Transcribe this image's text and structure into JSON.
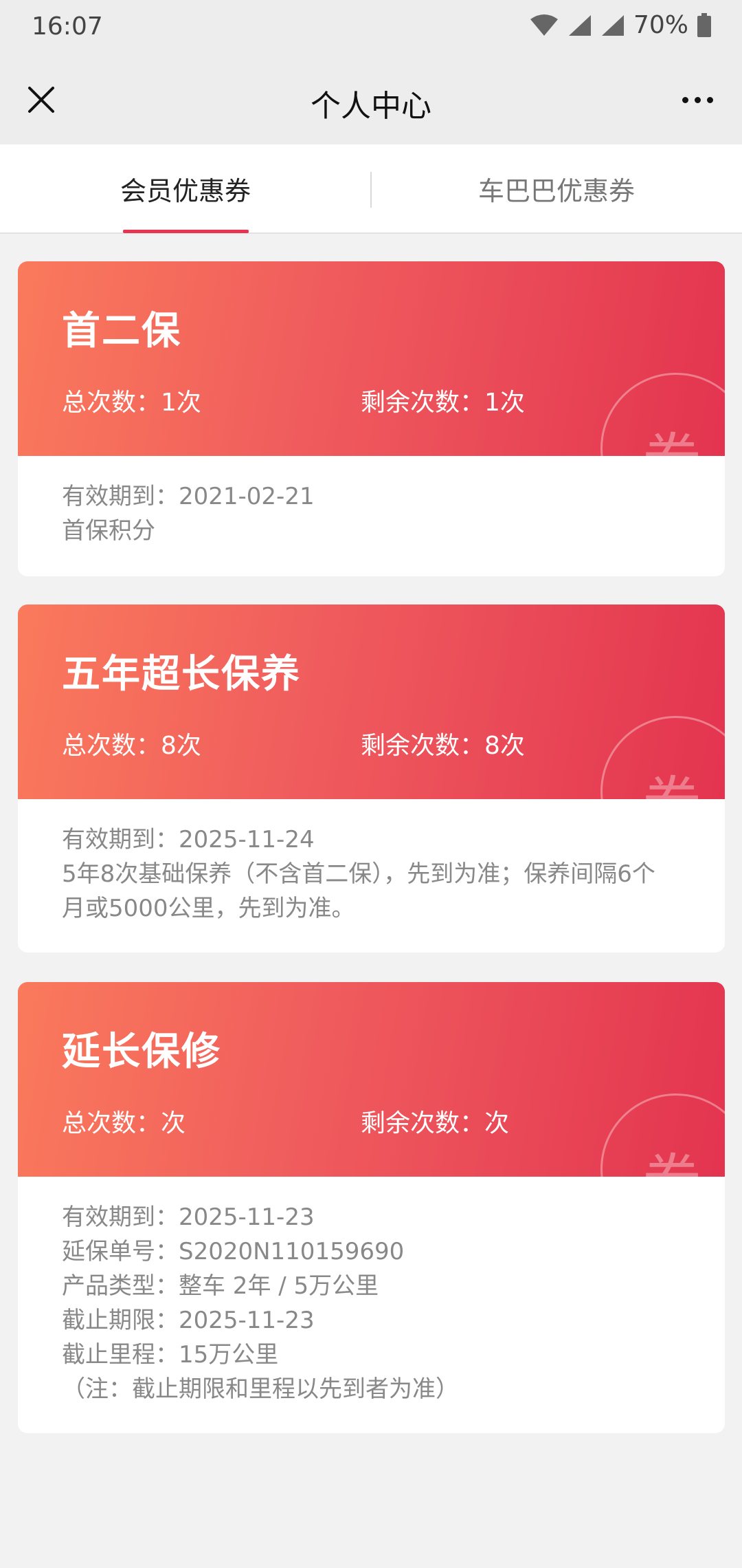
{
  "status_bar": {
    "time": "16:07",
    "battery": "70%"
  },
  "header": {
    "title": "个人中心"
  },
  "tabs": [
    {
      "label": "会员优惠券",
      "active": true
    },
    {
      "label": "车巴巴优惠券",
      "active": false
    }
  ],
  "stamp_label": "券",
  "accent_color": "#e8354f",
  "cards": [
    {
      "title": "首二保",
      "total": "总次数：1次",
      "remaining": "剩余次数：1次",
      "lines": [
        "有效期到：2021-02-21",
        "首保积分"
      ]
    },
    {
      "title": "五年超长保养",
      "total": "总次数：8次",
      "remaining": "剩余次数：8次",
      "lines": [
        "有效期到：2025-11-24",
        "5年8次基础保养（不含首二保），先到为准；保养间隔6个",
        "月或5000公里，先到为准。"
      ]
    },
    {
      "title": "延长保修",
      "total": "总次数：次",
      "remaining": "剩余次数：次",
      "lines": [
        "有效期到：2025-11-23",
        "延保单号：S2020N110159690",
        "产品类型：整车 2年 / 5万公里",
        "截止期限：2025-11-23",
        "截止里程：15万公里",
        "（注：截止期限和里程以先到者为准）"
      ]
    }
  ]
}
